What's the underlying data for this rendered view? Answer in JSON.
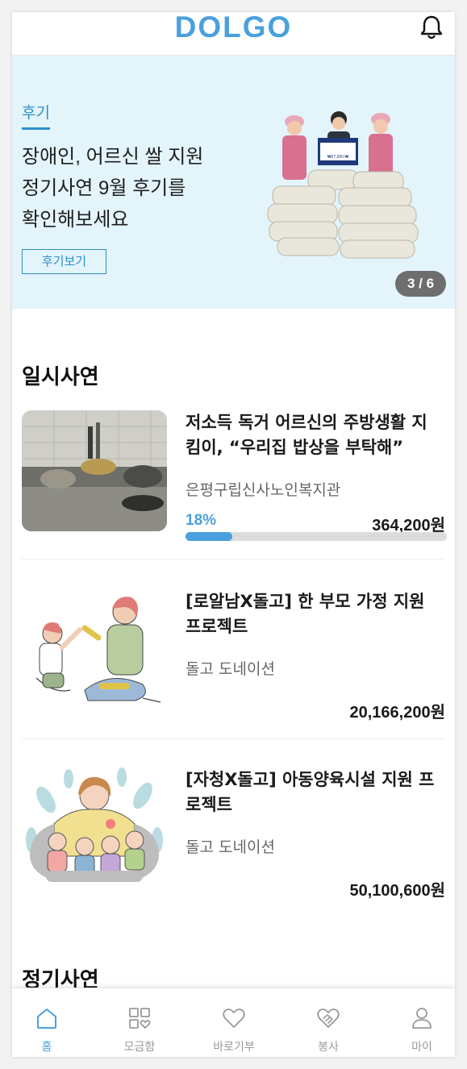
{
  "header": {
    "logo": "DOLGO",
    "bell_icon": "bell-icon"
  },
  "banner": {
    "tag": "후기",
    "title_lines": [
      "장애인, 어르신 쌀 지원",
      "정기사연 9월 후기를",
      "확인해보세요"
    ],
    "button_label": "후기보기",
    "pager": "3 / 6",
    "sign_text": "₩27,000 ₩",
    "bg_color": "#e3f4fb"
  },
  "sections": {
    "temporary": "일시사연",
    "regular": "정기사연"
  },
  "items": [
    {
      "title": "저소득 독거 어르신의 주방생활 지킴이, “우리집 밥상을 부탁해”",
      "title_lines": [
        "저소득 독거 어르신의 주방생활 지",
        "킴이, “우리집 밥상을 부탁해”"
      ],
      "org": "은평구립신사노인복지관",
      "rate_label": "18%",
      "rate": 0.18,
      "amount": "364,200원"
    },
    {
      "title_lines": [
        "[로알남X돌고] 한 부모 가정 지원",
        "프로젝트"
      ],
      "org": "돌고 도네이션",
      "amount": "20,166,200원"
    },
    {
      "title_lines": [
        "[자청X돌고] 아동양육시설 지원 프",
        "로젝트"
      ],
      "org": "돌고 도네이션",
      "amount": "50,100,600원"
    }
  ],
  "nav": [
    {
      "label": "홈",
      "icon": "home-icon",
      "active": true
    },
    {
      "label": "모금함",
      "icon": "grid-heart-icon",
      "active": false
    },
    {
      "label": "바로기부",
      "icon": "heart-icon",
      "active": false
    },
    {
      "label": "봉사",
      "icon": "handshake-heart-icon",
      "active": false
    },
    {
      "label": "마이",
      "icon": "person-icon",
      "active": false
    }
  ],
  "colors": {
    "accent": "#4aa0dc",
    "tag": "#2d8fc8",
    "pager_bg": "#6e6e6e"
  }
}
